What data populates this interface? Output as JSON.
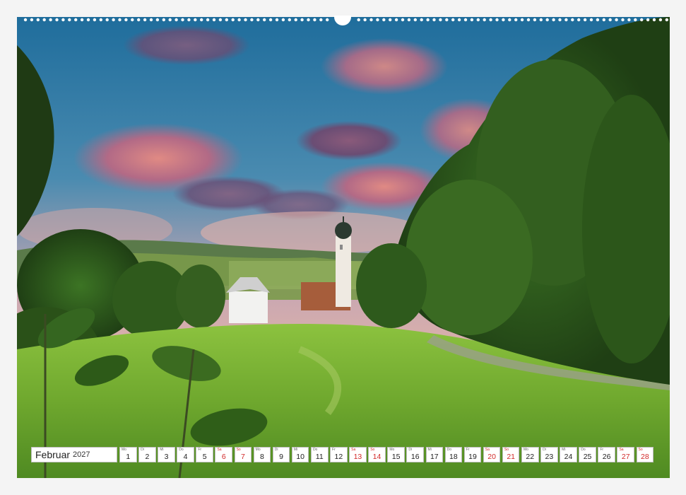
{
  "calendar": {
    "month": "Februar",
    "year": "2027",
    "days": [
      {
        "weekday": "Mo",
        "day": "1",
        "weekend": false
      },
      {
        "weekday": "Di",
        "day": "2",
        "weekend": false
      },
      {
        "weekday": "Mi",
        "day": "3",
        "weekend": false
      },
      {
        "weekday": "Do",
        "day": "4",
        "weekend": false
      },
      {
        "weekday": "Fr",
        "day": "5",
        "weekend": false
      },
      {
        "weekday": "Sa",
        "day": "6",
        "weekend": true
      },
      {
        "weekday": "So",
        "day": "7",
        "weekend": true
      },
      {
        "weekday": "Mo",
        "day": "8",
        "weekend": false
      },
      {
        "weekday": "Di",
        "day": "9",
        "weekend": false
      },
      {
        "weekday": "Mi",
        "day": "10",
        "weekend": false
      },
      {
        "weekday": "Do",
        "day": "11",
        "weekend": false
      },
      {
        "weekday": "Fr",
        "day": "12",
        "weekend": false
      },
      {
        "weekday": "Sa",
        "day": "13",
        "weekend": true
      },
      {
        "weekday": "So",
        "day": "14",
        "weekend": true
      },
      {
        "weekday": "Mo",
        "day": "15",
        "weekend": false
      },
      {
        "weekday": "Di",
        "day": "16",
        "weekend": false
      },
      {
        "weekday": "Mi",
        "day": "17",
        "weekend": false
      },
      {
        "weekday": "Do",
        "day": "18",
        "weekend": false
      },
      {
        "weekday": "Fr",
        "day": "19",
        "weekend": false
      },
      {
        "weekday": "Sa",
        "day": "20",
        "weekend": true
      },
      {
        "weekday": "So",
        "day": "21",
        "weekend": true
      },
      {
        "weekday": "Mo",
        "day": "22",
        "weekend": false
      },
      {
        "weekday": "Di",
        "day": "23",
        "weekend": false
      },
      {
        "weekday": "Mi",
        "day": "24",
        "weekend": false
      },
      {
        "weekday": "Do",
        "day": "25",
        "weekend": false
      },
      {
        "weekday": "Fr",
        "day": "26",
        "weekend": false
      },
      {
        "weekday": "Sa",
        "day": "27",
        "weekend": true
      },
      {
        "weekday": "So",
        "day": "28",
        "weekend": true
      }
    ]
  },
  "colors": {
    "weekend": "#d22a2a",
    "sky_top": "#1d6f9f",
    "meadow": "#7fb83a",
    "forest": "#2f5a1c"
  }
}
